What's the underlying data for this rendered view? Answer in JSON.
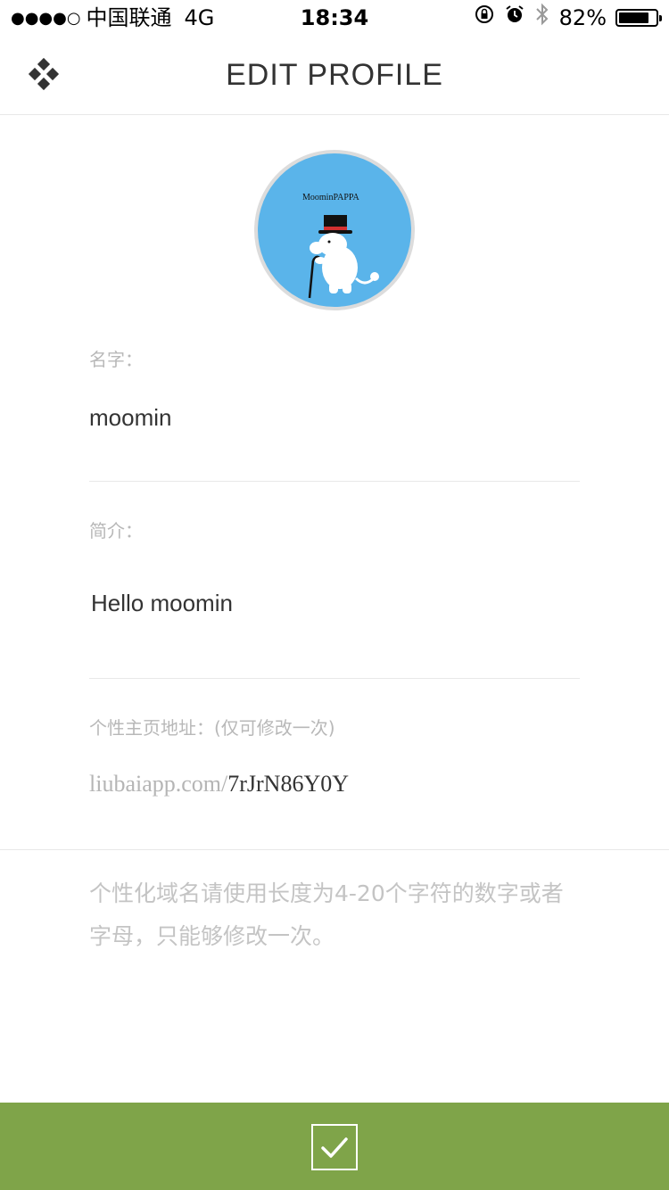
{
  "status_bar": {
    "signal_dots": "●●●●○",
    "carrier": "中国联通",
    "network": "4G",
    "time": "18:34",
    "battery_percent": "82%",
    "battery_level": 0.82,
    "icons": [
      "rotation-lock-icon",
      "alarm-icon",
      "bluetooth-icon",
      "battery-icon"
    ]
  },
  "nav": {
    "menu_icon": "four-diamond-menu-icon",
    "title": "EDIT PROFILE"
  },
  "profile": {
    "avatar_icon": "moomin-pappa-avatar",
    "avatar_logo_text": "MoominPAPPA",
    "avatar_bg": "#5ab4ea",
    "name_label": "名字：",
    "name_value": "moomin",
    "bio_label": "简介：",
    "bio_value": "Hello moomin",
    "url_label": "个性主页地址：(仅可修改一次)",
    "url_prefix": "liubaiapp.com/",
    "url_code": "7rJrN86Y0Y",
    "hint": "个性化域名请使用长度为4-20个字符的数字或者字母，只能够修改一次。"
  },
  "footer": {
    "confirm_icon": "checkmark-icon",
    "accent_color": "#7fa449"
  }
}
